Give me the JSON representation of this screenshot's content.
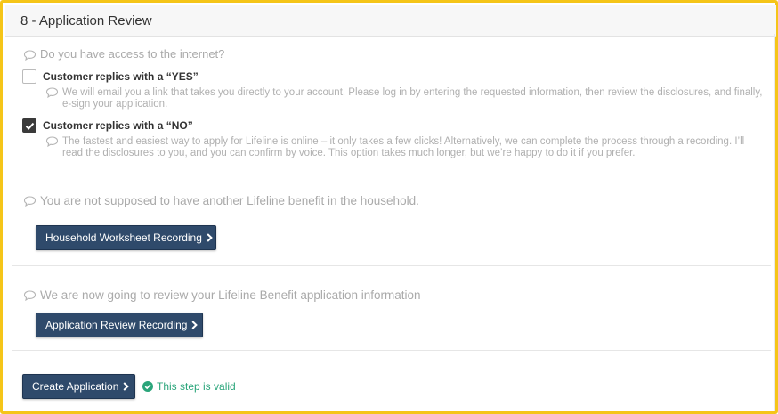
{
  "header": {
    "title": "8 -  Application Review"
  },
  "questions": {
    "internet": "Do you have access to the internet?",
    "benefit": "You are not supposed to have another Lifeline benefit in the household.",
    "review": "We are now going to review your Lifeline Benefit application information"
  },
  "options": [
    {
      "label": "Customer replies with a “YES”",
      "checked": false,
      "description": "We will email you a link that takes you directly to your account. Please log in by entering the requested information, then review the disclosures, and finally, e-sign your application."
    },
    {
      "label": "Customer replies with a “NO”",
      "checked": true,
      "description": "The fastest and easiest way to apply for Lifeline is online – it only takes a few clicks! Alternatively, we can complete the process through a recording. I’ll read the disclosures to you, and you can confirm by voice. This option takes much longer, but we’re happy to do it if you prefer."
    }
  ],
  "buttons": {
    "household": "Household Worksheet Recording",
    "application_review": "Application  Review  Recording",
    "create": "Create Application"
  },
  "status": {
    "valid_text": "This step is valid"
  },
  "colors": {
    "frame": "#f5c518",
    "button": "#2f4a6b",
    "valid": "#2aa57a",
    "muted_text": "#aaaaaa"
  },
  "icons": {
    "question": "comment-bubble-icon",
    "button_arrow": "chevron-right-icon",
    "valid": "check-circle-icon"
  }
}
